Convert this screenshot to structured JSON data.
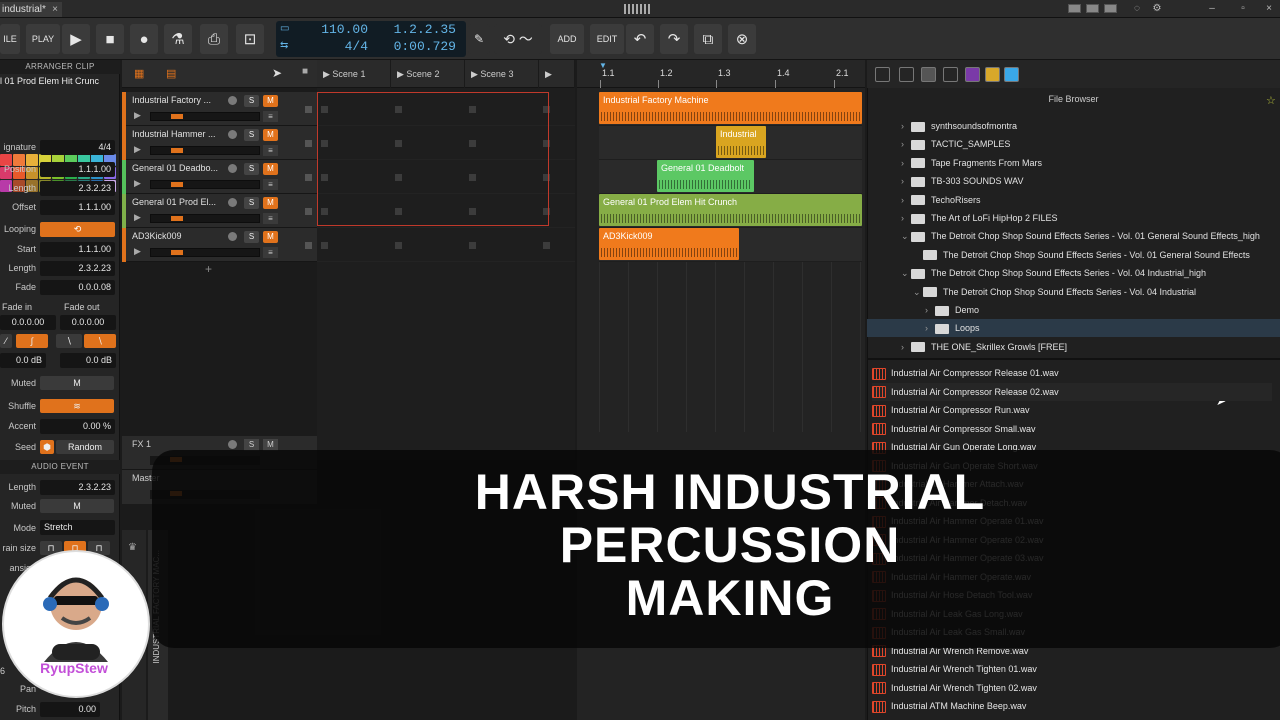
{
  "window": {
    "doc_tab": "industrial*",
    "close": "×",
    "minimize": "–",
    "maximize": "▫",
    "win_close": "×"
  },
  "toolbar": {
    "file": "ILE",
    "play_label": "PLAY",
    "add": "ADD",
    "edit": "EDIT",
    "tempo": "110.00",
    "time_sig": "4/4",
    "position_bars": "1.2.2.35",
    "position_time": "0:00.729"
  },
  "inspector": {
    "header": "ARRANGER CLIP",
    "clip_name": "l 01 Prod Elem Hit Crunc",
    "signature_label": "ignature",
    "signature": "4/4",
    "position_label": "Position",
    "position": "1.1.1.00",
    "length_label": "Length",
    "length": "2.3.2.23",
    "offset_label": "Offset",
    "offset": "1.1.1.00",
    "looping_label": "Looping",
    "start_label": "Start",
    "start": "1.1.1.00",
    "loop_length_label": "Length",
    "loop_length": "2.3.2.23",
    "fade_label": "Fade",
    "fade": "0.0.0.08",
    "fade_in_label": "Fade in",
    "fade_out_label": "Fade out",
    "fade_in": "0.0.0.00",
    "fade_out": "0.0.0.00",
    "fade_in_db": "0.0 dB",
    "fade_out_db": "0.0 dB",
    "muted_label": "Muted",
    "muted_btn": "M",
    "shuffle_label": "Shuffle",
    "accent_label": "Accent",
    "accent": "0.00 %",
    "seed_label": "Seed",
    "seed_mode": "Random",
    "audio_header": "AUDIO EVENT",
    "ae_length_label": "Length",
    "ae_length": "2.3.2.23",
    "ae_muted_label": "Muted",
    "ae_muted_btn": "M",
    "mode_label": "Mode",
    "mode": "Stretch",
    "grain_label": "rain size",
    "transient_label": "ansien",
    "pan_label": "Pan",
    "pitch_label": "Pitch",
    "pitch": "0.00",
    "side_label_6": "6"
  },
  "tracks": [
    {
      "name": "Industrial Factory ...",
      "color": "#e0721c"
    },
    {
      "name": "Industrial Hammer ...",
      "color": "#e0721c"
    },
    {
      "name": "General 01 Deadbo...",
      "color": "#55c25c"
    },
    {
      "name": "General 01 Prod El...",
      "color": "#7fb04a"
    },
    {
      "name": "AD3Kick009",
      "color": "#e0721c"
    }
  ],
  "fx": {
    "name": "FX 1",
    "master": "Master"
  },
  "track_btn": {
    "s": "S",
    "m": "M"
  },
  "scenes": [
    "Scene 1",
    "Scene 2",
    "Scene 3"
  ],
  "ruler": [
    "1.1",
    "1.2",
    "1.3",
    "1.4",
    "2.1"
  ],
  "clips": [
    {
      "name": "Industrial Factory Machine",
      "color": "#f07a1c"
    },
    {
      "name": "Industrial",
      "color": "#d9a520"
    },
    {
      "name": "General 01 Deadbolt",
      "color": "#5cc864"
    },
    {
      "name": "General 01 Prod Elem Hit Crunch",
      "color": "#86ad46"
    },
    {
      "name": "AD3Kick009",
      "color": "#f07a1c"
    }
  ],
  "vertical_track_label": "INDUSTRIAL FACTORY MAC...",
  "browser": {
    "title": "File Browser",
    "folders": [
      "synthsoundsofmontra",
      "TACTIC_SAMPLES",
      "Tape Fragments From Mars",
      "TB-303 SOUNDS WAV",
      "TechoRisers",
      "The Art of LoFi HipHop 2 FILES",
      "The Detroit Chop Shop Sound Effects Series - Vol. 01 General Sound Effects_high",
      "The Detroit Chop Shop Sound Effects Series - Vol. 01 General Sound Effects",
      "The Detroit Chop Shop Sound Effects Series - Vol. 04 Industrial_high",
      "The Detroit Chop Shop Sound Effects Series - Vol. 04 Industrial",
      "Demo",
      "Loops",
      "THE ONE_Skrillex Growls [FREE]"
    ],
    "files": [
      "Industrial Air Compressor Release 01.wav",
      "Industrial Air Compressor Release 02.wav",
      "Industrial Air Compressor Run.wav",
      "Industrial Air Compressor Small.wav",
      "Industrial Air Gun Operate Long.wav",
      "Industrial Air Gun Operate Short.wav",
      "Industrial Air Hammer Attach.wav",
      "Industrial Air Hammer Detach.wav",
      "Industrial Air Hammer Operate 01.wav",
      "Industrial Air Hammer Operate 02.wav",
      "Industrial Air Hammer Operate 03.wav",
      "Industrial Air Hammer Operate.wav",
      "Industrial Air Hose Detach Tool.wav",
      "Industrial Air Leak Gas Long.wav",
      "Industrial Air Leak Gas Small.wav",
      "Industrial Air Wrench Remove.wav",
      "Industrial Air Wrench Tighten 01.wav",
      "Industrial Air Wrench Tighten 02.wav",
      "Industrial ATM Machine Beep.wav"
    ]
  },
  "overlay": {
    "line1": "HARSH INDUSTRIAL",
    "line2": "PERCUSSION",
    "line3": "MAKING"
  },
  "avatar": {
    "label": "RyupStew"
  },
  "colors": {
    "accent": "#e0721c",
    "transport_text": "#63b4e6"
  }
}
